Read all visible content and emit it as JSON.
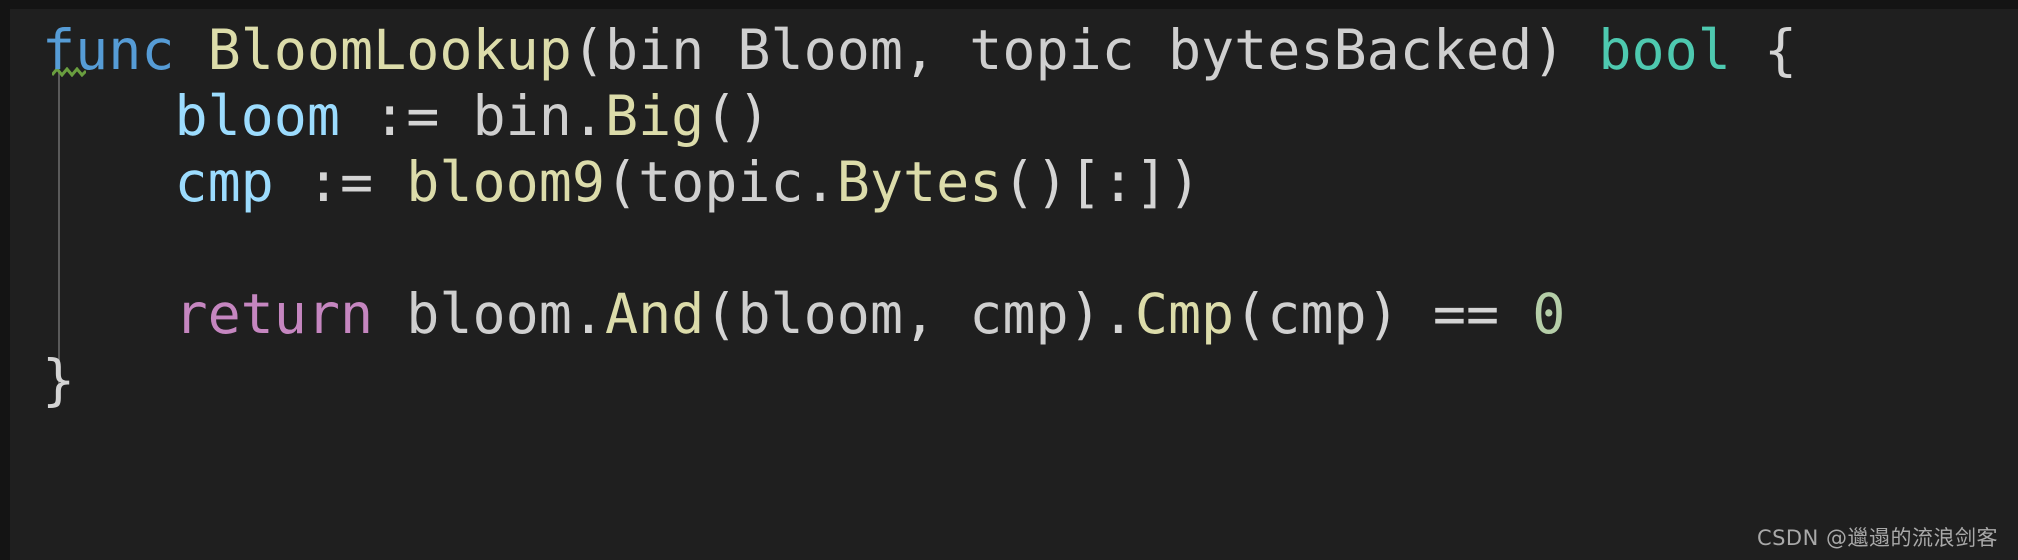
{
  "editor": {
    "language": "Go",
    "background_color": "#1f1f1f",
    "frame_color": "#141414",
    "colors": {
      "keyword": "#569cd6",
      "control_keyword": "#c586c0",
      "function": "#dcdcaa",
      "variable": "#9cdcfe",
      "type": "#4ec9b0",
      "plain": "#d4d4d4",
      "number": "#b5cea8",
      "indent_guide": "#5a5a5a",
      "squiggle": "#6a9e3f"
    },
    "indent_guide_visible": true,
    "squiggle_marker": {
      "name": "green-squiggly-underline",
      "color": "#6a9e3f",
      "under_token": "func"
    },
    "lines": [
      {
        "number": 1,
        "text": "func BloomLookup(bin Bloom, topic bytesBacked) bool {",
        "tokens": [
          {
            "text": "func",
            "kind": "keyword"
          },
          {
            "text": " ",
            "kind": "plain"
          },
          {
            "text": "BloomLookup",
            "kind": "function"
          },
          {
            "text": "(",
            "kind": "plain"
          },
          {
            "text": "bin",
            "kind": "param"
          },
          {
            "text": " ",
            "kind": "plain"
          },
          {
            "text": "Bloom",
            "kind": "param"
          },
          {
            "text": ", ",
            "kind": "plain"
          },
          {
            "text": "topic",
            "kind": "param"
          },
          {
            "text": " ",
            "kind": "plain"
          },
          {
            "text": "bytesBacked",
            "kind": "param"
          },
          {
            "text": ") ",
            "kind": "plain"
          },
          {
            "text": "bool",
            "kind": "type"
          },
          {
            "text": " {",
            "kind": "plain"
          }
        ]
      },
      {
        "number": 2,
        "text": "    bloom := bin.Big()",
        "tokens": [
          {
            "text": "    ",
            "kind": "plain"
          },
          {
            "text": "bloom",
            "kind": "variable"
          },
          {
            "text": " := ",
            "kind": "plain"
          },
          {
            "text": "bin",
            "kind": "param"
          },
          {
            "text": ".",
            "kind": "plain"
          },
          {
            "text": "Big",
            "kind": "function"
          },
          {
            "text": "()",
            "kind": "plain"
          }
        ]
      },
      {
        "number": 3,
        "text": "    cmp := bloom9(topic.Bytes()[:])",
        "tokens": [
          {
            "text": "    ",
            "kind": "plain"
          },
          {
            "text": "cmp",
            "kind": "variable"
          },
          {
            "text": " := ",
            "kind": "plain"
          },
          {
            "text": "bloom9",
            "kind": "function"
          },
          {
            "text": "(",
            "kind": "plain"
          },
          {
            "text": "topic",
            "kind": "param"
          },
          {
            "text": ".",
            "kind": "plain"
          },
          {
            "text": "Bytes",
            "kind": "function"
          },
          {
            "text": "()[:])",
            "kind": "plain"
          }
        ]
      },
      {
        "number": 4,
        "text": "",
        "tokens": []
      },
      {
        "number": 5,
        "text": "    return bloom.And(bloom, cmp).Cmp(cmp) == 0",
        "tokens": [
          {
            "text": "    ",
            "kind": "plain"
          },
          {
            "text": "return",
            "kind": "control"
          },
          {
            "text": " ",
            "kind": "plain"
          },
          {
            "text": "bloom",
            "kind": "param"
          },
          {
            "text": ".",
            "kind": "plain"
          },
          {
            "text": "And",
            "kind": "function"
          },
          {
            "text": "(",
            "kind": "plain"
          },
          {
            "text": "bloom",
            "kind": "param"
          },
          {
            "text": ", ",
            "kind": "plain"
          },
          {
            "text": "cmp",
            "kind": "param"
          },
          {
            "text": ").",
            "kind": "plain"
          },
          {
            "text": "Cmp",
            "kind": "function"
          },
          {
            "text": "(",
            "kind": "plain"
          },
          {
            "text": "cmp",
            "kind": "param"
          },
          {
            "text": ") == ",
            "kind": "plain"
          },
          {
            "text": "0",
            "kind": "number"
          }
        ]
      },
      {
        "number": 6,
        "text": "}",
        "tokens": [
          {
            "text": "}",
            "kind": "plain"
          }
        ]
      }
    ]
  },
  "watermark": {
    "text": "CSDN @邋遢的流浪剑客"
  }
}
